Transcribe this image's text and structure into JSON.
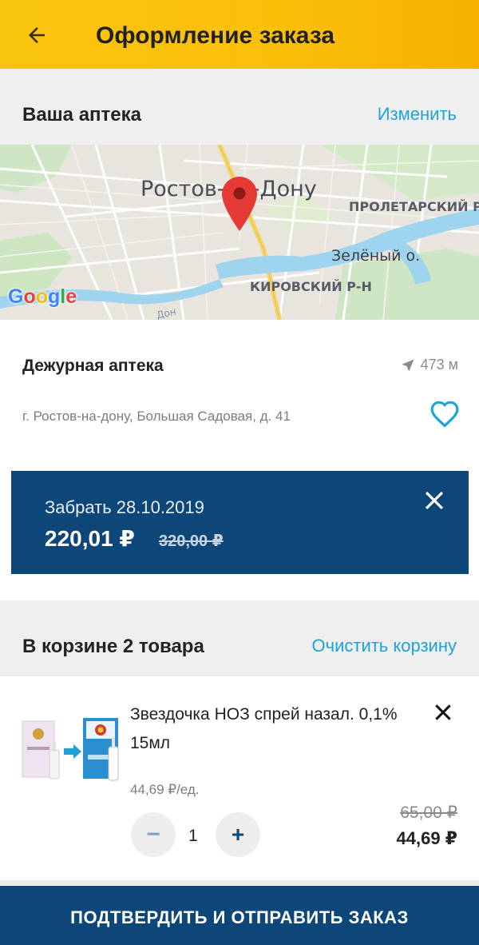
{
  "appbar": {
    "title": "Оформление заказа",
    "back_icon": "arrow-left-icon"
  },
  "pharmacy_section": {
    "title": "Ваша аптека",
    "change_label": "Изменить"
  },
  "map": {
    "labels": {
      "city": "Ростов-на-Дону",
      "district_1": "ПРОЛЕТАРСКИЙ Р-",
      "island": "Зелёный о.",
      "district_2": "КИРОВСКИЙ Р-Н",
      "river": "Дон"
    },
    "logo": "Google"
  },
  "pharmacy": {
    "name": "Дежурная аптека",
    "distance": "473 м",
    "address": "г. Ростов-на-дону, Большая Садовая, д. 41"
  },
  "pickup": {
    "date_label": "Забрать 28.10.2019",
    "price": "220,01 ₽",
    "old_price": "320,00 ₽"
  },
  "cart_section": {
    "title": "В корзине 2 товара",
    "clear_label": "Очистить корзину"
  },
  "cart_item": {
    "name": "Звездочка НОЗ спрей назал. 0,1% 15мл",
    "unit_price": "44,69 ₽/ед.",
    "quantity": "1",
    "old_price": "65,00 ₽",
    "price": "44,69 ₽",
    "minus": "−",
    "plus": "+"
  },
  "confirm_button": "ПОДТВЕРДИТЬ И ОТПРАВИТЬ ЗАКАЗ",
  "colors": {
    "appbar": "#f9c40f",
    "accent": "#1ea3d8",
    "primary_dark": "#0d4779",
    "map_pin": "#e53935"
  }
}
